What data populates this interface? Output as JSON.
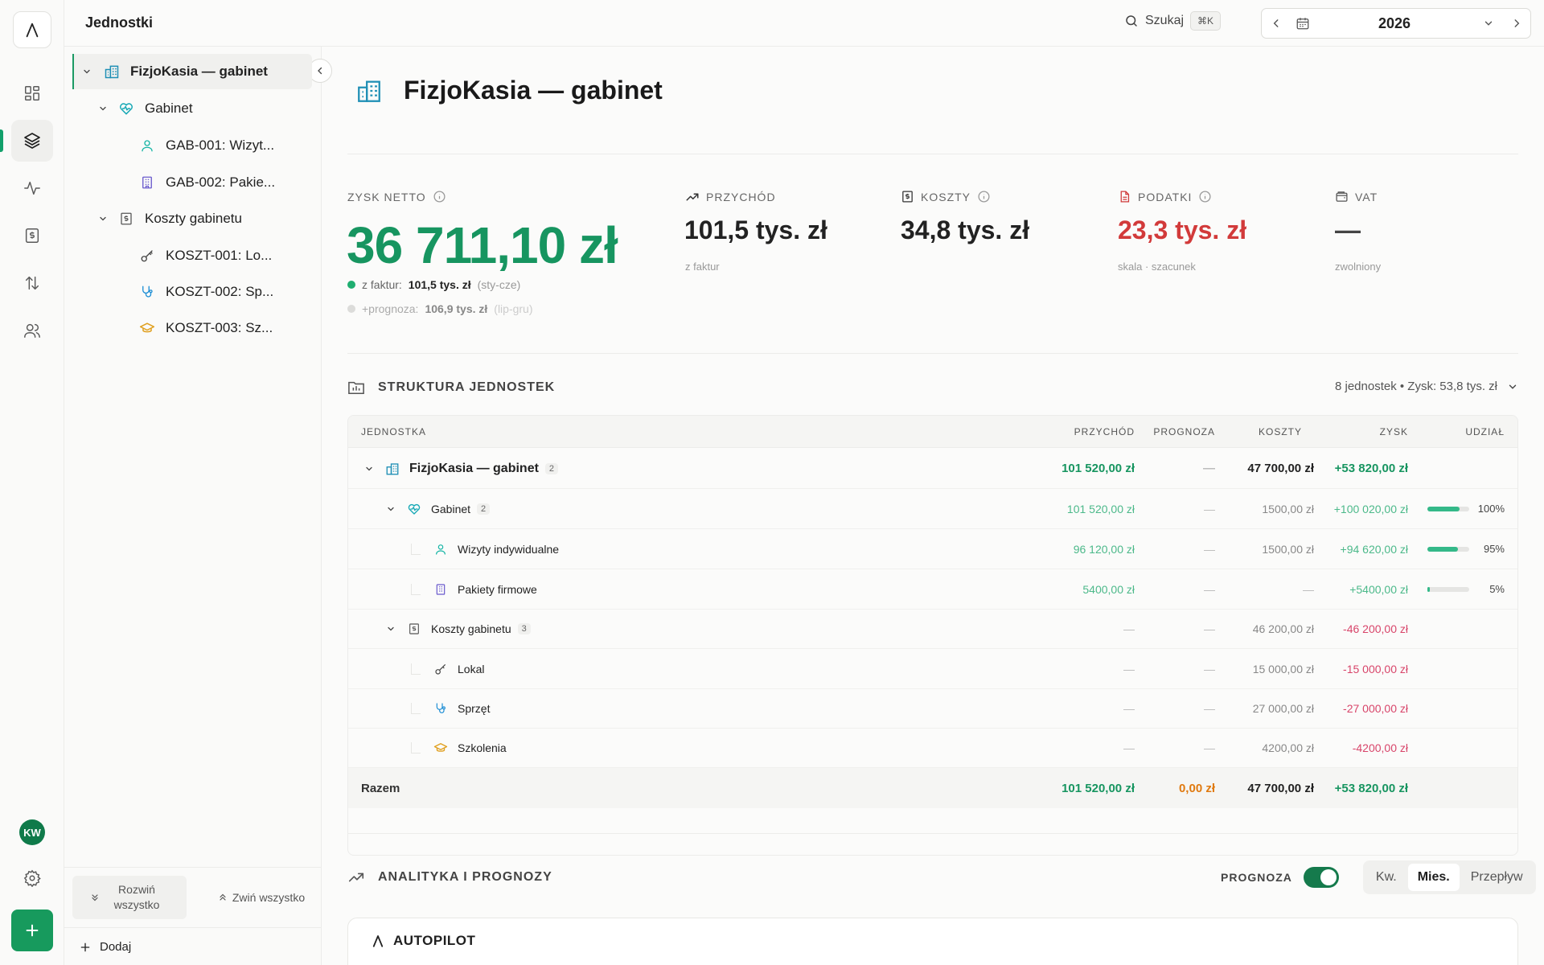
{
  "header": {
    "title": "Jednostki",
    "search_label": "Szukaj",
    "search_shortcut": "⌘K",
    "year": "2026"
  },
  "rail": {
    "avatar_initials": "KW",
    "accent": "#179a5d"
  },
  "tree": {
    "root": "FizjoKasia — gabinet",
    "group1": "Gabinet",
    "g1_items": [
      "GAB-001: Wizyt...",
      "GAB-002: Pakie..."
    ],
    "group2": "Koszty gabinetu",
    "g2_items": [
      "KOSZT-001: Lo...",
      "KOSZT-002: Sp...",
      "KOSZT-003: Sz..."
    ],
    "expand_all": "Rozwiń wszystko",
    "collapse_all": "Zwiń wszystko",
    "add": "Dodaj"
  },
  "page": {
    "title": "FizjoKasia — gabinet"
  },
  "stats": {
    "profit_label": "ZYSK NETTO",
    "profit_value": "36 711,10 zł",
    "legend1_prefix": "z faktur:",
    "legend1_value": "101,5 tys. zł",
    "legend1_range": "(sty-cze)",
    "legend2_prefix": "+prognoza:",
    "legend2_value": "106,9 tys. zł",
    "legend2_range": "(lip-gru)",
    "revenue_label": "PRZYCHÓD",
    "revenue_value": "101,5 tys. zł",
    "revenue_sub": "z faktur",
    "costs_label": "KOSZTY",
    "costs_value": "34,8 tys. zł",
    "taxes_label": "PODATKI",
    "taxes_value": "23,3 tys. zł",
    "taxes_sub": "skala · szacunek",
    "vat_label": "VAT",
    "vat_value": "—",
    "vat_sub": "zwolniony"
  },
  "structure": {
    "label": "STRUKTURA JEDNOSTEK",
    "meta": "8 jednostek • Zysk: 53,8 tys. zł",
    "columns": [
      "JEDNOSTKA",
      "PRZYCHÓD",
      "PROGNOZA",
      "KOSZTY",
      "ZYSK",
      "UDZIAŁ"
    ],
    "rows": [
      {
        "name": "FizjoKasia — gabinet",
        "count": "2",
        "revenue": "101 520,00 zł",
        "forecast": "—",
        "costs": "47 700,00 zł",
        "profit": "+53 820,00 zł",
        "share": null,
        "share_label": ""
      },
      {
        "name": "Gabinet",
        "count": "2",
        "revenue": "101 520,00 zł",
        "forecast": "—",
        "costs": "1500,00 zł",
        "profit": "+100 020,00 zł",
        "share": 100,
        "share_label": "100%"
      },
      {
        "name": "Wizyty indywidualne",
        "count": "",
        "revenue": "96 120,00 zł",
        "forecast": "—",
        "costs": "1500,00 zł",
        "profit": "+94 620,00 zł",
        "share": 95,
        "share_label": "95%"
      },
      {
        "name": "Pakiety firmowe",
        "count": "",
        "revenue": "5400,00 zł",
        "forecast": "—",
        "costs": "—",
        "profit": "+5400,00 zł",
        "share": 5,
        "share_label": "5%"
      },
      {
        "name": "Koszty gabinetu",
        "count": "3",
        "revenue": "—",
        "forecast": "—",
        "costs": "46 200,00 zł",
        "profit": "-46 200,00 zł",
        "share": null,
        "share_label": ""
      },
      {
        "name": "Lokal",
        "count": "",
        "revenue": "—",
        "forecast": "—",
        "costs": "15 000,00 zł",
        "profit": "-15 000,00 zł",
        "share": null,
        "share_label": ""
      },
      {
        "name": "Sprzęt",
        "count": "",
        "revenue": "—",
        "forecast": "—",
        "costs": "27 000,00 zł",
        "profit": "-27 000,00 zł",
        "share": null,
        "share_label": ""
      },
      {
        "name": "Szkolenia",
        "count": "",
        "revenue": "—",
        "forecast": "—",
        "costs": "4200,00 zł",
        "profit": "-4200,00 zł",
        "share": null,
        "share_label": ""
      }
    ],
    "total": {
      "name": "Razem",
      "revenue": "101 520,00 zł",
      "forecast": "0,00 zł",
      "costs": "47 700,00 zł",
      "profit": "+53 820,00 zł"
    }
  },
  "analytics": {
    "label": "ANALITYKA I PROGNOZY",
    "forecast_toggle_label": "PROGNOZA",
    "forecast_on": true,
    "segments": [
      "Kw.",
      "Mies.",
      "Przepływ"
    ],
    "selected_segment": "Mies.",
    "autopilot_label": "AUTOPILOT"
  }
}
